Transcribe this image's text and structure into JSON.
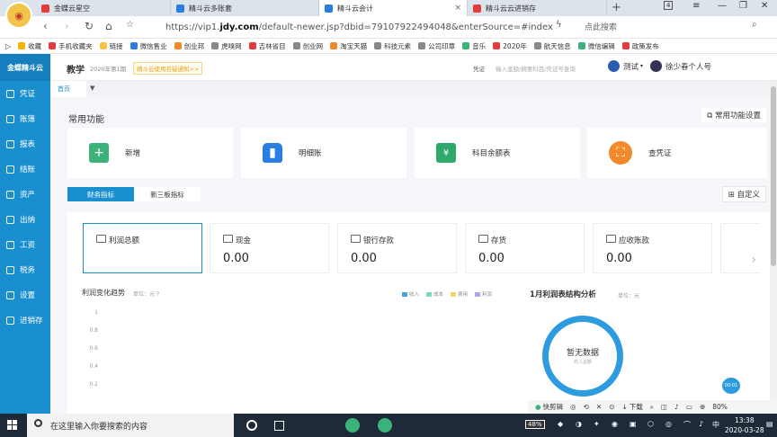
{
  "browser": {
    "tabs": [
      {
        "label": "金蝶云星空",
        "color": "#e23b3b"
      },
      {
        "label": "精斗云多账套",
        "color": "#2a7de1"
      },
      {
        "label": "精斗云会计",
        "color": "#2a7de1"
      },
      {
        "label": "精斗云云进销存",
        "color": "#e23b3b"
      }
    ],
    "tab_count": "4",
    "url_prefix": "https://vip1.",
    "url_host": "jdy.com",
    "url_suffix": "/default-newer.jsp?dbid=79107922494048&enterSource=#index",
    "search_label": "点此搜索",
    "bookmarks": [
      "收藏",
      "手机收藏夹",
      "链接",
      "微信售业",
      "创业邦",
      "虎嗅网",
      "吉林省目",
      "创业网",
      "淘宝天猫",
      "科技元素",
      "公司印章",
      "音乐",
      "2020年",
      "航天信息",
      "微信编辑",
      "政策发布"
    ]
  },
  "sidebar": {
    "logo": "金蝶精斗云",
    "items": [
      "凭证",
      "账簿",
      "报表",
      "结账",
      "资产",
      "出纳",
      "工资",
      "税务",
      "设置",
      "进销存"
    ]
  },
  "header": {
    "title": "教学",
    "period": "2020年第1期",
    "notice": "精斗云使用答疑通知>>",
    "search_select": "凭证",
    "search_placeholder": "输入金额/摘要科目/凭证号查询",
    "test_label": "测试",
    "user_name": "徐少春个人号"
  },
  "breadcrumb": {
    "home": "首页"
  },
  "common": {
    "title": "常用功能",
    "settings_label": "常用功能设置",
    "items": [
      {
        "label": "新增",
        "color": "#3bb27a"
      },
      {
        "label": "明细账",
        "color": "#2a7de1"
      },
      {
        "label": "科目余额表",
        "color": "#2fa86b"
      },
      {
        "label": "查凭证",
        "color": "#f08a2a"
      }
    ]
  },
  "panel_tabs": [
    "财务指标",
    "新三板指标"
  ],
  "custom_label": "自定义",
  "metrics": [
    {
      "name": "利润总额",
      "value": ""
    },
    {
      "name": "现金",
      "value": "0.00"
    },
    {
      "name": "银行存款",
      "value": "0.00"
    },
    {
      "name": "存货",
      "value": "0.00"
    },
    {
      "name": "应收账款",
      "value": "0.00"
    }
  ],
  "profit_chart": {
    "title": "利润变化趋势",
    "unit": "单位：元",
    "legend": [
      {
        "name": "收入",
        "color": "#4aa3df"
      },
      {
        "name": "成本",
        "color": "#7fd6c0"
      },
      {
        "name": "费用",
        "color": "#f5d36b"
      },
      {
        "name": "利润",
        "color": "#a8a8e8"
      }
    ],
    "yticks": [
      "1",
      "0.8",
      "0.6",
      "0.4",
      "0.2"
    ]
  },
  "pie": {
    "title": "1月利润表结构分析",
    "unit": "单位：元",
    "empty_text": "暂无数据",
    "empty_sub": "收入总额"
  },
  "bubble": "00:01",
  "statusbar": [
    "快剪辑",
    "下载",
    "80%"
  ],
  "taskbar": {
    "search_placeholder": "在这里输入你要搜索的内容",
    "battery": "48%",
    "ime": "中",
    "time": "13:38",
    "date": "2020-03-28"
  }
}
